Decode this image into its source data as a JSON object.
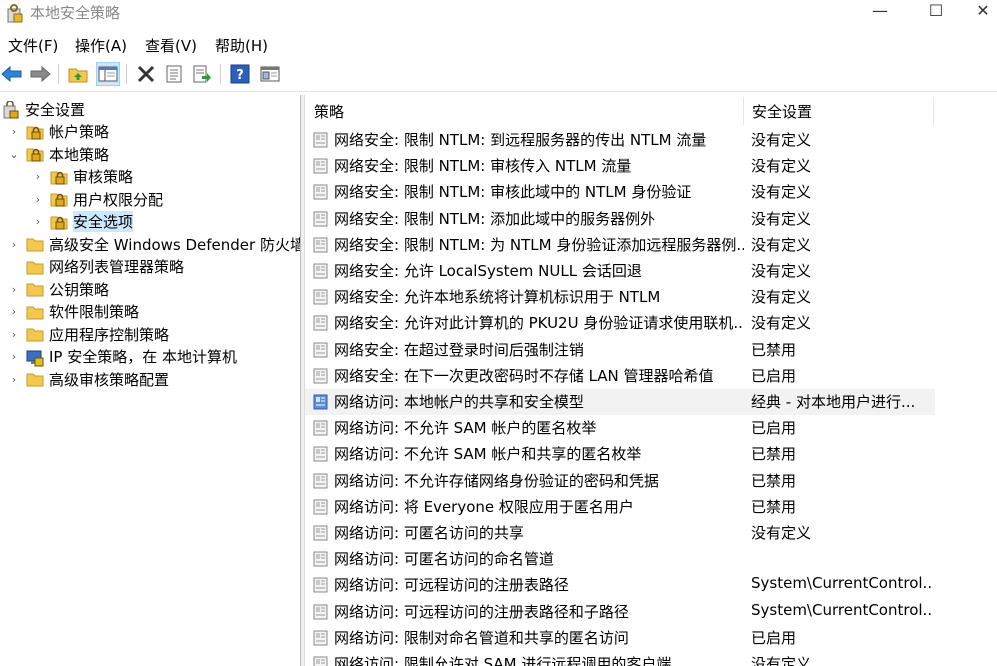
{
  "window": {
    "title": "本地安全策略",
    "minimize": "—",
    "maximize": "☐",
    "close": "✕"
  },
  "menu": [
    "文件(F)",
    "操作(A)",
    "查看(V)",
    "帮助(H)"
  ],
  "tree": [
    {
      "label": "安全设置",
      "level": 0,
      "expander": "",
      "icon": "security-settings-icon"
    },
    {
      "label": "帐户策略",
      "level": 1,
      "expander": "›",
      "icon": "policy-folder-icon"
    },
    {
      "label": "本地策略",
      "level": 1,
      "expander": "⌄",
      "icon": "policy-folder-icon"
    },
    {
      "label": "审核策略",
      "level": 2,
      "expander": "›",
      "icon": "policy-folder-icon"
    },
    {
      "label": "用户权限分配",
      "level": 2,
      "expander": "›",
      "icon": "policy-folder-icon"
    },
    {
      "label": "安全选项",
      "level": 2,
      "expander": "›",
      "icon": "policy-folder-icon",
      "selected": true
    },
    {
      "label": "高级安全 Windows Defender 防火墙",
      "level": 1,
      "expander": "›",
      "icon": "folder-icon"
    },
    {
      "label": "网络列表管理器策略",
      "level": 1,
      "expander": "",
      "icon": "folder-icon"
    },
    {
      "label": "公钥策略",
      "level": 1,
      "expander": "›",
      "icon": "folder-icon"
    },
    {
      "label": "软件限制策略",
      "level": 1,
      "expander": "›",
      "icon": "folder-icon"
    },
    {
      "label": "应用程序控制策略",
      "level": 1,
      "expander": "›",
      "icon": "folder-icon"
    },
    {
      "label": "IP 安全策略，在 本地计算机",
      "level": 1,
      "expander": "›",
      "icon": "ip-security-icon"
    },
    {
      "label": "高级审核策略配置",
      "level": 1,
      "expander": "›",
      "icon": "folder-icon"
    }
  ],
  "columns": {
    "policy": "策略",
    "setting": "安全设置",
    "sort_arrow": "⌃"
  },
  "rows": [
    {
      "policy": "网络安全: 限制 NTLM: 到远程服务器的传出 NTLM 流量",
      "setting": "没有定义"
    },
    {
      "policy": "网络安全: 限制 NTLM: 审核传入 NTLM 流量",
      "setting": "没有定义"
    },
    {
      "policy": "网络安全: 限制 NTLM: 审核此域中的 NTLM 身份验证",
      "setting": "没有定义"
    },
    {
      "policy": "网络安全: 限制 NTLM: 添加此域中的服务器例外",
      "setting": "没有定义"
    },
    {
      "policy": "网络安全: 限制 NTLM: 为 NTLM 身份验证添加远程服务器例...",
      "setting": "没有定义"
    },
    {
      "policy": "网络安全: 允许 LocalSystem NULL 会话回退",
      "setting": "没有定义"
    },
    {
      "policy": "网络安全: 允许本地系统将计算机标识用于 NTLM",
      "setting": "没有定义"
    },
    {
      "policy": "网络安全: 允许对此计算机的 PKU2U 身份验证请求使用联机...",
      "setting": "没有定义"
    },
    {
      "policy": "网络安全: 在超过登录时间后强制注销",
      "setting": "已禁用"
    },
    {
      "policy": "网络安全: 在下一次更改密码时不存储 LAN 管理器哈希值",
      "setting": "已启用"
    },
    {
      "policy": "网络访问: 本地帐户的共享和安全模型",
      "setting": "经典 - 对本地用户进行...",
      "highlight": true
    },
    {
      "policy": "网络访问: 不允许 SAM 帐户的匿名枚举",
      "setting": "已启用"
    },
    {
      "policy": "网络访问: 不允许 SAM 帐户和共享的匿名枚举",
      "setting": "已禁用"
    },
    {
      "policy": "网络访问: 不允许存储网络身份验证的密码和凭据",
      "setting": "已禁用"
    },
    {
      "policy": "网络访问: 将 Everyone 权限应用于匿名用户",
      "setting": "已禁用"
    },
    {
      "policy": "网络访问: 可匿名访问的共享",
      "setting": "没有定义"
    },
    {
      "policy": "网络访问: 可匿名访问的命名管道",
      "setting": ""
    },
    {
      "policy": "网络访问: 可远程访问的注册表路径",
      "setting": "System\\CurrentControl..."
    },
    {
      "policy": "网络访问: 可远程访问的注册表路径和子路径",
      "setting": "System\\CurrentControl..."
    },
    {
      "policy": "网络访问: 限制对命名管道和共享的匿名访问",
      "setting": "已启用"
    },
    {
      "policy": "网络访问: 限制允许对 SAM 进行远程调用的客户端",
      "setting": "没有定义"
    }
  ],
  "toolbar": [
    "back-arrow-icon",
    "forward-arrow-icon",
    "up-folder-icon",
    "show-hide-tree-icon",
    "delete-icon",
    "properties-icon",
    "export-list-icon",
    "help-icon",
    "console-icon"
  ]
}
